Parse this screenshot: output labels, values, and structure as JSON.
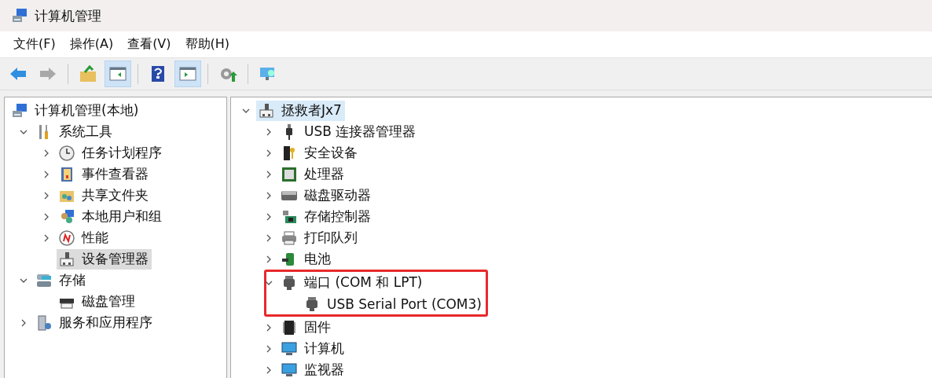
{
  "window": {
    "title": "计算机管理"
  },
  "menu": [
    "文件(F)",
    "操作(A)",
    "查看(V)",
    "帮助(H)"
  ],
  "toolbar": [
    {
      "disabled": false,
      "pressed": false
    },
    {
      "disabled": true,
      "pressed": false
    },
    {
      "disabled": false,
      "pressed": false
    },
    {
      "disabled": false,
      "pressed": true
    },
    {
      "disabled": false,
      "pressed": false
    },
    {
      "disabled": false,
      "pressed": true
    },
    {
      "disabled": false,
      "pressed": false
    },
    {
      "disabled": false,
      "pressed": false
    }
  ],
  "console_tree": [
    {
      "label": "计算机管理(本地)",
      "selected": false,
      "children": [
        {
          "label": "系统工具",
          "expanded": true,
          "selected": false,
          "children": [
            {
              "label": "任务计划程序",
              "expanded": false,
              "selected": false
            },
            {
              "label": "事件查看器",
              "expanded": false,
              "selected": false
            },
            {
              "label": "共享文件夹",
              "expanded": false,
              "selected": false
            },
            {
              "label": "本地用户和组",
              "expanded": false,
              "selected": false
            },
            {
              "label": "性能",
              "expanded": false,
              "selected": false
            },
            {
              "label": "设备管理器",
              "selected": true
            }
          ]
        },
        {
          "label": "存储",
          "expanded": true,
          "selected": false,
          "children": [
            {
              "label": "磁盘管理",
              "selected": false
            }
          ]
        },
        {
          "label": "服务和应用程序",
          "expanded": false,
          "selected": false
        }
      ]
    }
  ],
  "device_tree": [
    {
      "label": "拯救者Jx7",
      "expanded": true,
      "selected": true,
      "highlighted": false,
      "children": [
        {
          "label": "USB 连接器管理器",
          "expanded": false,
          "selected": false,
          "highlighted": false
        },
        {
          "label": "安全设备",
          "expanded": false,
          "selected": false,
          "highlighted": false
        },
        {
          "label": "处理器",
          "expanded": false,
          "selected": false,
          "highlighted": false
        },
        {
          "label": "磁盘驱动器",
          "expanded": false,
          "selected": false,
          "highlighted": false
        },
        {
          "label": "存储控制器",
          "expanded": false,
          "selected": false,
          "highlighted": false
        },
        {
          "label": "打印队列",
          "expanded": false,
          "selected": false,
          "highlighted": false
        },
        {
          "label": "电池",
          "expanded": false,
          "selected": false,
          "highlighted": false
        },
        {
          "label": "端口 (COM 和 LPT)",
          "expanded": true,
          "selected": false,
          "highlighted": true,
          "children": [
            {
              "label": "USB Serial Port (COM3)",
              "selected": false,
              "highlighted": false
            }
          ]
        },
        {
          "label": "固件",
          "expanded": false,
          "selected": false,
          "highlighted": false
        },
        {
          "label": "计算机",
          "expanded": false,
          "selected": false,
          "highlighted": false
        },
        {
          "label": "监视器",
          "expanded": false,
          "selected": false,
          "highlighted": false
        }
      ]
    }
  ]
}
